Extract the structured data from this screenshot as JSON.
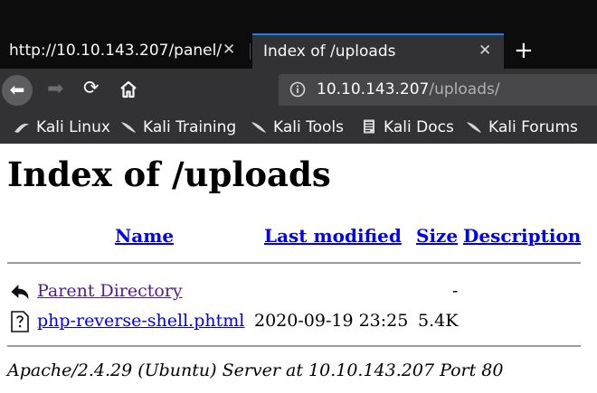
{
  "browser": {
    "tabs": [
      {
        "title": "http://10.10.143.207/panel/",
        "close": "✕",
        "active": false
      },
      {
        "title": "Index of /uploads",
        "close": "✕",
        "active": true
      }
    ],
    "new_tab": "+",
    "nav": {
      "back": "⬅",
      "forward": "➡",
      "reload": "⟳",
      "home_icon": "home-icon"
    },
    "url": {
      "host": "10.10.143.207",
      "path": "/uploads/"
    },
    "bookmarks": [
      "Kali Linux",
      "Kali Training",
      "Kali Tools",
      "Kali Docs",
      "Kali Forums"
    ],
    "accent_color": "#0a84ff"
  },
  "page": {
    "title": "Index of /uploads",
    "columns": {
      "name": "Name",
      "last_modified": "Last modified",
      "size": "Size",
      "description": "Description"
    },
    "rows": [
      {
        "icon": "back-arrow-icon",
        "name": "Parent Directory",
        "modified": "",
        "size": "-",
        "description": ""
      },
      {
        "icon": "unknown-file-icon",
        "name": "php-reverse-shell.phtml",
        "modified": "2020-09-19 23:25",
        "size": "5.4K",
        "description": ""
      }
    ],
    "server_signature": "Apache/2.4.29 (Ubuntu) Server at 10.10.143.207 Port 80"
  }
}
